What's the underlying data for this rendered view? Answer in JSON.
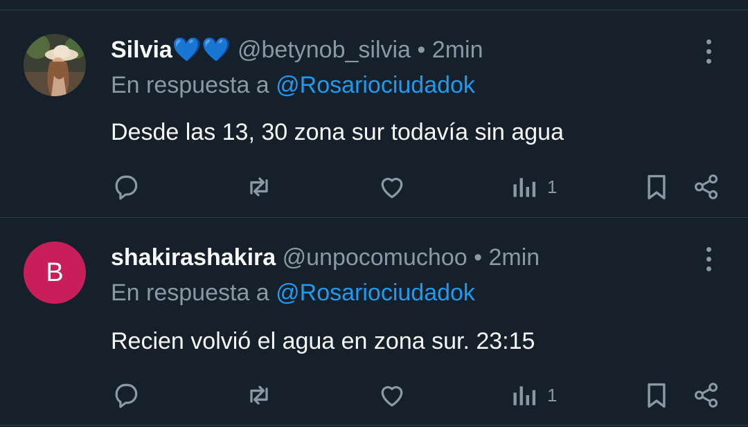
{
  "tweets": [
    {
      "name": "Silvia",
      "emoji": "💙💙",
      "handle": "@betynob_silvia",
      "dot": "•",
      "time": "2min",
      "reply_prefix": "En respuesta a",
      "reply_to": "@Rosariociudadok",
      "text": "Desde las 13, 30 zona sur todavía sin agua",
      "views": "1",
      "avatar": "photo"
    },
    {
      "name": "shakirashakira",
      "emoji": "",
      "handle": "@unpocomuchoo",
      "dot": "•",
      "time": "2min",
      "reply_prefix": "En respuesta a",
      "reply_to": "@Rosariociudadok",
      "text": "Recien volvió el agua en zona sur. 23:15",
      "views": "1",
      "avatar_letter": "B",
      "avatar_color": "#c81e5a"
    }
  ],
  "icons": [
    "reply-icon",
    "retweet-icon",
    "like-icon",
    "views-icon",
    "bookmark-icon",
    "share-icon",
    "more-icon"
  ],
  "colors": {
    "background": "#15202b",
    "link": "#1d9bf0",
    "muted": "#8b98a5",
    "text": "#f7f9f9"
  }
}
